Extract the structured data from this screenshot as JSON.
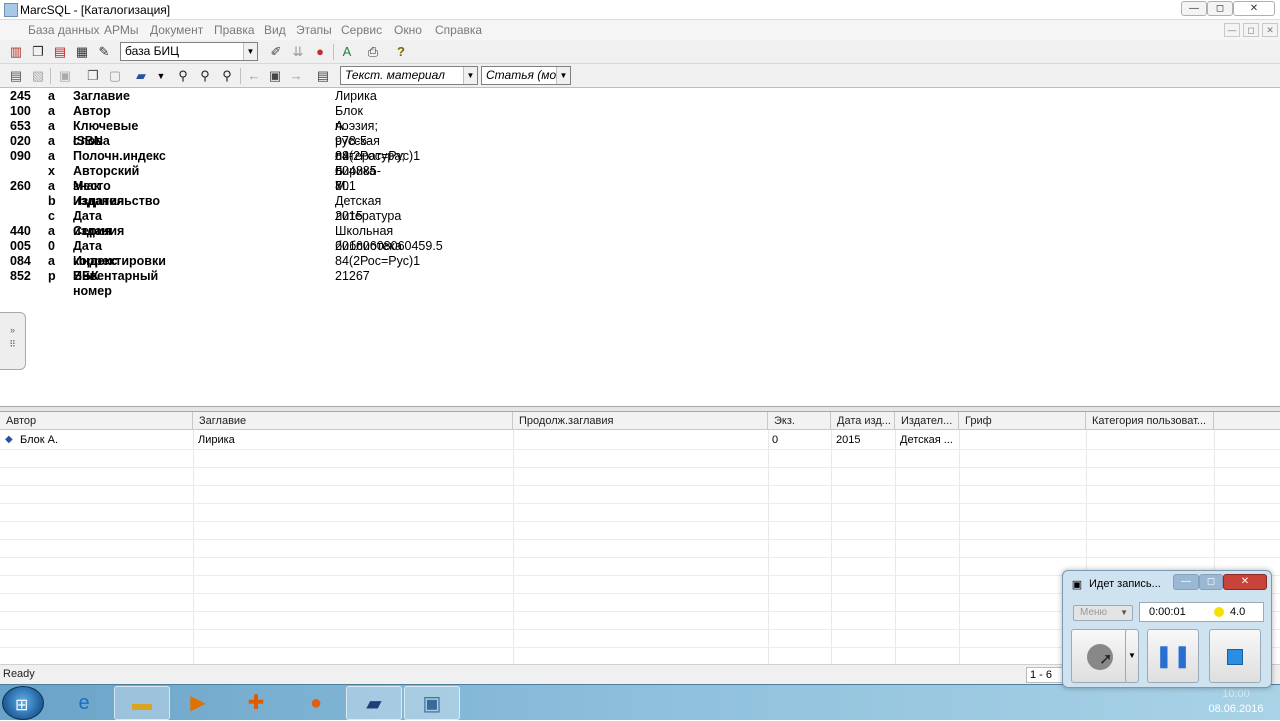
{
  "window": {
    "title": "MarcSQL - [Каталогизация]",
    "app_icon": "app-icon"
  },
  "window_buttons": {
    "minimize": "—",
    "maximize": "◻",
    "close": "✕"
  },
  "mdi_buttons": {
    "minimize": "—",
    "restore": "◻",
    "close": "✕"
  },
  "menu": [
    "База данных",
    "АРМы",
    "Документ",
    "Правка",
    "Вид",
    "Этапы",
    "Сервис",
    "Окно",
    "Справка"
  ],
  "toolbar1": {
    "database_select": "база БИЦ",
    "icons": [
      "books-icon",
      "copy-icon",
      "printer-red-icon",
      "documents-icon",
      "wrench-icon",
      "arrows-down-icon",
      "traffic-light-icon",
      "a-tool-icon",
      "print-icon",
      "help-icon"
    ]
  },
  "toolbar2": {
    "material_select": "Текст. материал",
    "level_select": "Статья (мо",
    "icons": [
      "new-doc-icon",
      "edit-doc-icon",
      "save-icon",
      "copy-doc-icon",
      "paste-doc-icon",
      "book-icon",
      "search-icon",
      "search-filter-icon",
      "search-all-icon",
      "arrow-left-icon",
      "page-icon",
      "arrow-right-icon",
      "card-icon"
    ]
  },
  "record": [
    {
      "tag": "245",
      "sub": "a",
      "name": "Заглавие",
      "value": "Лирика"
    },
    {
      "tag": "100",
      "sub": "a",
      "name": "Автор",
      "value": "Блок А."
    },
    {
      "tag": "653",
      "sub": "a",
      "name": "Ключевые слова",
      "value": "поэзия; русская литература; лирика"
    },
    {
      "tag": "020",
      "sub": "a",
      "name": "ISBN",
      "value": "978-5-08-004885-8"
    },
    {
      "tag": "090",
      "sub": "a",
      "name": "Полочн.индекс",
      "value": "84(2Рос=Рус)1"
    },
    {
      "tag": "",
      "sub": "x",
      "name": "Авторский знак",
      "value": "Б 701"
    },
    {
      "tag": "260",
      "sub": "a",
      "name": "Место издания",
      "value": "М."
    },
    {
      "tag": "",
      "sub": "b",
      "name": "Издательство",
      "value": "Детская литература"
    },
    {
      "tag": "",
      "sub": "c",
      "name": "Дата издания",
      "value": "2015"
    },
    {
      "tag": "440",
      "sub": "a",
      "name": "Серия",
      "value": "Школьная библиотека"
    },
    {
      "tag": "005",
      "sub": "0",
      "name": "Дата корректировки",
      "value": "20160608060459.5"
    },
    {
      "tag": "084",
      "sub": "a",
      "name": "Индекс ББК",
      "value": "84(2Рос=Рус)1"
    },
    {
      "tag": "852",
      "sub": "p",
      "name": "Инвентарный номер",
      "value": "21267"
    }
  ],
  "grid": {
    "columns": [
      "Автор",
      "Заглавие",
      "Продолж.заглавия",
      "Экз.",
      "Дата изд...",
      "Издател...",
      "Гриф",
      "Категория пользоват..."
    ],
    "rows": [
      {
        "author": "Блок А.",
        "title": "Лирика",
        "subtitle": "",
        "copies": "0",
        "year": "2015",
        "publisher": "Детская ...",
        "grif": "",
        "category": ""
      }
    ]
  },
  "status": {
    "text": "Ready",
    "page": "1 - 6"
  },
  "recorder": {
    "title": "Идет запись...",
    "menu_label": "Меню",
    "time": "0:00:01",
    "level": "4.0",
    "buttons": {
      "record": "record-icon",
      "pause": "pause-icon",
      "stop": "stop-icon"
    }
  },
  "taskbar": {
    "apps": [
      "ie-icon",
      "explorer-icon",
      "media-player-icon",
      "app-orange-icon",
      "firefox-icon",
      "marcsql-book-icon",
      "recorder-app-icon"
    ],
    "time": "10:00",
    "date": "08.06.2016"
  },
  "colors": {
    "accent": "#2a6fb0",
    "taskbar": "#8ec0dc",
    "record_level": "#f5e000"
  }
}
